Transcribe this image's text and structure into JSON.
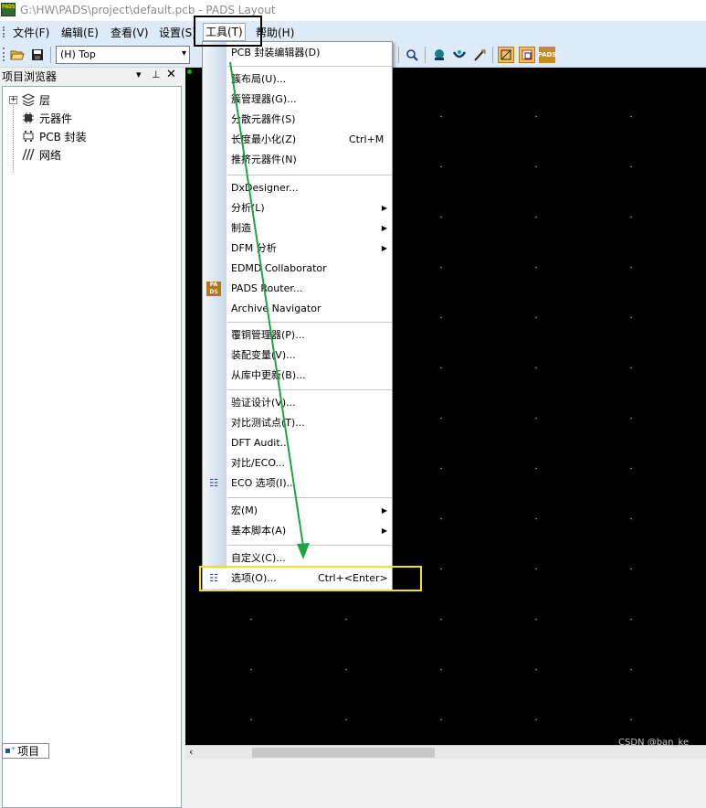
{
  "window": {
    "logo_text": "PADS",
    "title": "G:\\HW\\PADS\\project\\default.pcb - PADS Layout"
  },
  "menubar": {
    "items": [
      {
        "label": "文件(F)"
      },
      {
        "label": "编辑(E)"
      },
      {
        "label": "查看(V)"
      },
      {
        "label": "设置(S)"
      },
      {
        "label": "工具(T)"
      },
      {
        "label": "帮助(H)"
      }
    ]
  },
  "toolbar": {
    "open_icon": "folder-open-icon",
    "save_icon": "save-icon",
    "layer_select_value": "(H) Top",
    "icons_right": [
      "zoom-icon",
      "view-icon",
      "route-icon",
      "sketch-icon",
      "pads-icon-1",
      "pads-icon-2",
      "pads-icon-3"
    ]
  },
  "project_browser": {
    "title": "项目浏览器",
    "pin_icon": "pin-icon",
    "close_icon": "close-icon",
    "tree": [
      {
        "label": "层",
        "icon": "layers-icon"
      },
      {
        "label": "元器件",
        "icon": "component-icon"
      },
      {
        "label": "PCB 封装",
        "icon": "footprint-icon"
      },
      {
        "label": "网络",
        "icon": "net-icon"
      }
    ],
    "tab_label": "项目"
  },
  "tools_menu": {
    "sections": [
      [
        {
          "label": "PCB 封装编辑器(D)"
        }
      ],
      [
        {
          "label": "簇布局(U)..."
        },
        {
          "label": "簇管理器(G)..."
        },
        {
          "label": "分散元器件(S)"
        },
        {
          "label": "长度最小化(Z)",
          "shortcut": "Ctrl+M"
        },
        {
          "label": "推挤元器件(N)"
        }
      ],
      [
        {
          "label": "DxDesigner..."
        },
        {
          "label": "分析(L)",
          "submenu": true
        },
        {
          "label": "制造",
          "submenu": true
        },
        {
          "label": "DFM 分析",
          "submenu": true
        },
        {
          "label": "EDMD Collaborator"
        },
        {
          "label": "PADS Router...",
          "icon": "pads-router-icon"
        },
        {
          "label": "Archive Navigator"
        }
      ],
      [
        {
          "label": "覆铜管理器(P)..."
        },
        {
          "label": "装配变量(V)..."
        },
        {
          "label": "从库中更新(B)..."
        }
      ],
      [
        {
          "label": "验证设计(V)..."
        },
        {
          "label": "对比测试点(T)..."
        },
        {
          "label": "DFT Audit..."
        },
        {
          "label": "对比/ECO..."
        },
        {
          "label": "ECO 选项(I)...",
          "icon": "eco-options-icon"
        }
      ],
      [
        {
          "label": "宏(M)",
          "submenu": true
        },
        {
          "label": "基本脚本(A)",
          "submenu": true
        }
      ],
      [
        {
          "label": "自定义(C)..."
        },
        {
          "label": "选项(O)...",
          "shortcut": "Ctrl+<Enter>",
          "icon": "options-icon"
        }
      ]
    ]
  },
  "watermark": "CSDN @ban_ke",
  "colors": {
    "canvas_bg": "#000000",
    "grid_dot": "#9a9a9a",
    "menubar_bg": "#ddeaf7",
    "annotation_black": "#000000",
    "annotation_yellow": "#f0e020",
    "arrow_green": "#1fa345"
  }
}
